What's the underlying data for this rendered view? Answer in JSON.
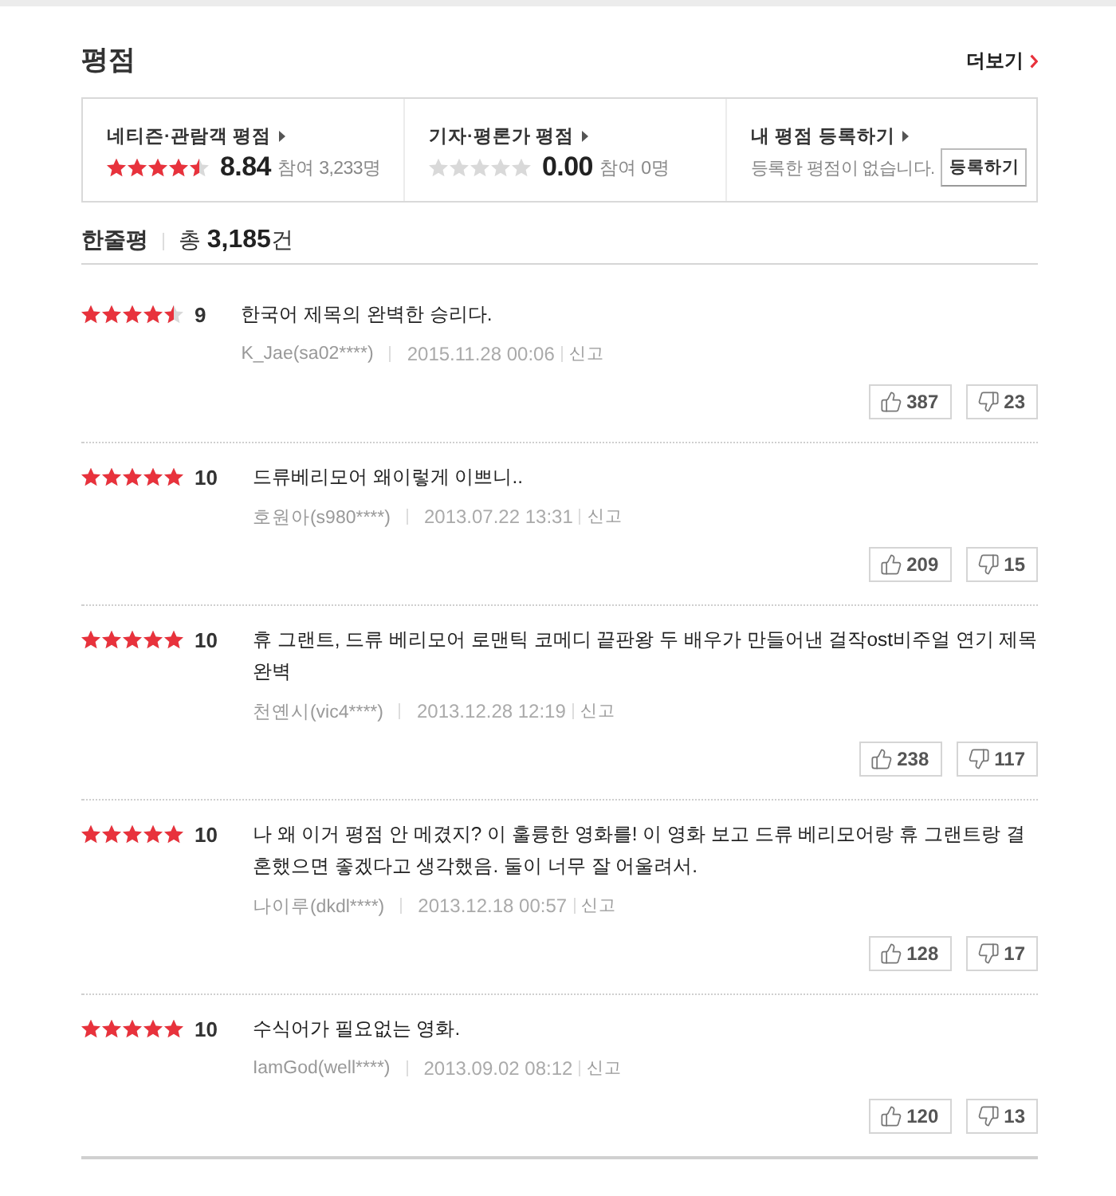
{
  "header": {
    "title": "평점",
    "more_link": "더보기"
  },
  "summary": [
    {
      "kind": "rating",
      "title": "네티즌·관람객 평점",
      "stars": 4.5,
      "score": "8.84",
      "participants": "참여 3,233명"
    },
    {
      "kind": "rating",
      "title": "기자·평론가 평점",
      "stars": 0,
      "score": "0.00",
      "participants": "참여 0명"
    },
    {
      "kind": "register",
      "title": "내 평점 등록하기",
      "message": "등록한 평점이 없습니다.",
      "button": "등록하기"
    }
  ],
  "comments_header": {
    "title": "한줄평",
    "total": "총 **3,185**건"
  },
  "reviews": [
    {
      "stars": 4.5,
      "score": "9",
      "text": "한국어 제목의 완벽한 승리다.",
      "author": "K_Jae(sa02****)",
      "date": "2015.11.28 00:06",
      "report": "신고",
      "likes": "387",
      "dislikes": "23"
    },
    {
      "stars": 5,
      "score": "10",
      "text": "드류베리모어 왜이렇게 이쁘니..",
      "author": "호원아(s980****)",
      "date": "2013.07.22 13:31",
      "report": "신고",
      "likes": "209",
      "dislikes": "15"
    },
    {
      "stars": 5,
      "score": "10",
      "text": "휴 그랜트, 드류 베리모어 로맨틱 코메디 끝판왕 두 배우가 만들어낸 걸작ost비주얼 연기 제목 완벽",
      "author": "천옌시(vic4****)",
      "date": "2013.12.28 12:19",
      "report": "신고",
      "likes": "238",
      "dislikes": "117"
    },
    {
      "stars": 5,
      "score": "10",
      "text": "나 왜 이거 평점 안 메겼지? 이 훌륭한 영화를! 이 영화 보고 드류 베리모어랑 휴 그랜트랑 결혼했으면 좋겠다고 생각했음. 둘이 너무 잘 어울려서.",
      "author": "나이루(dkdl****)",
      "date": "2013.12.18 00:57",
      "report": "신고",
      "likes": "128",
      "dislikes": "17"
    },
    {
      "stars": 5,
      "score": "10",
      "text": "수식어가 필요없는 영화.",
      "author": "IamGod(well****)",
      "date": "2013.09.02 08:12",
      "report": "신고",
      "likes": "120",
      "dislikes": "13"
    }
  ]
}
